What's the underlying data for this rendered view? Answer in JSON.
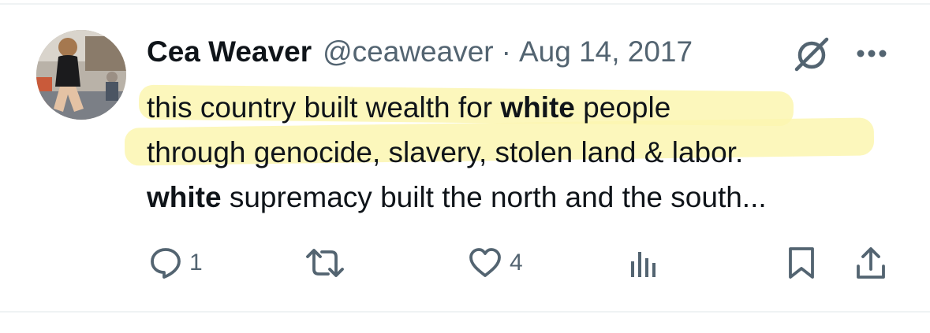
{
  "tweet": {
    "author_name": "Cea Weaver",
    "handle": "@ceaweaver",
    "separator": "·",
    "date": "Aug 14, 2017",
    "text_lines": [
      {
        "parts": [
          {
            "text": "this country built wealth for ",
            "bold": false
          },
          {
            "text": "white",
            "bold": true
          },
          {
            "text": " people",
            "bold": false
          }
        ]
      },
      {
        "parts": [
          {
            "text": "through genocide, slavery, stolen land & labor.",
            "bold": false
          }
        ]
      },
      {
        "parts": [
          {
            "text": "white",
            "bold": true
          },
          {
            "text": " supremacy built the north and the south...",
            "bold": false
          }
        ]
      }
    ]
  },
  "actions": {
    "reply_count": "1",
    "like_count": "4"
  },
  "icons": {
    "reply": "reply-icon",
    "retweet": "retweet-icon",
    "like": "heart-icon",
    "views": "views-icon",
    "bookmark": "bookmark-icon",
    "share": "share-icon",
    "grok": "grok-icon",
    "more": "more-icon"
  },
  "colors": {
    "text_primary": "#0f1419",
    "text_secondary": "#536471",
    "highlight": "#fbf6b0",
    "divider": "#eff3f4"
  }
}
